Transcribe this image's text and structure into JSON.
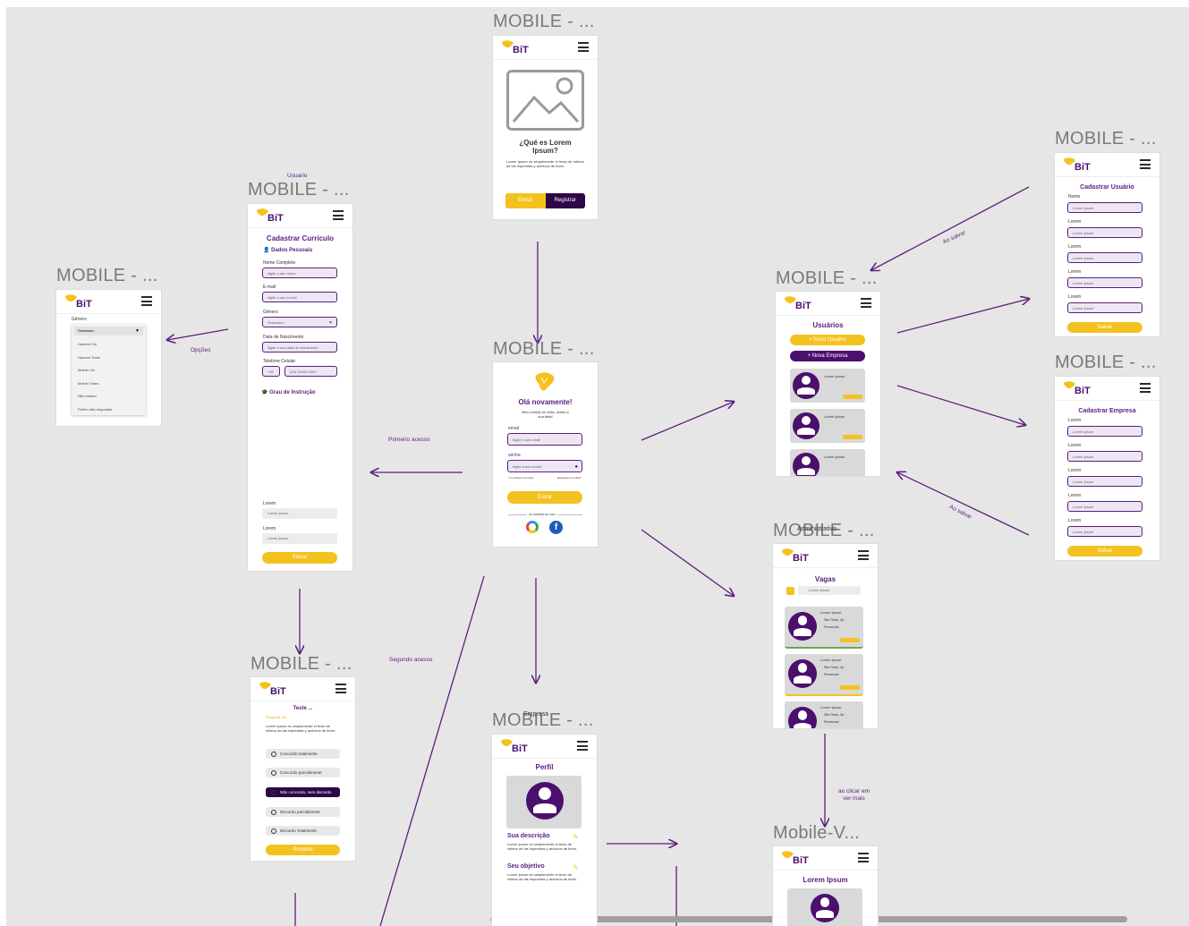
{
  "frame_titles": {
    "welcome": "MOBILE - ...",
    "opcoes": "MOBILE - ...",
    "curriculo": "MOBILE - ...",
    "login": "MOBILE - ...",
    "usuarios": "MOBILE - ...",
    "cad_usuario": "MOBILE - ...",
    "cad_empresa": "MOBILE - ...",
    "vagas": "MOBILE - ...",
    "teste": "MOBILE - ...",
    "perfil": "MOBILE - ...",
    "vermais": "Mobile-V..."
  },
  "logo_text": "BiT",
  "welcome": {
    "title": "¿Qué es Lorem Ipsum?",
    "text": "Lorem Ipsum es simplemente el texto de relleno de las imprentas y archivos de texto.",
    "btn_entrar": "Entrar",
    "btn_registrar": "Registrar"
  },
  "opcoes": {
    "label": "Gênero",
    "selected": "Selecione...",
    "options": [
      "Homem Cis",
      "Homem Trans",
      "Mulher Cis",
      "Mulher Trans",
      "Não-binário",
      "Prefiro não responder"
    ]
  },
  "curriculo": {
    "title": "Cadastrar Currículo",
    "section1": "Dados Pessoais",
    "nome_label": "Nome Completo",
    "nome_ph": "digite o seu nome",
    "email_label": "E-mail",
    "email_ph": "digite o seu e-mail",
    "genero_label": "Gênero",
    "genero_ph": "Selecione...",
    "nasc_label": "Data de Nascimento",
    "nasc_ph": "digite a sua data de nascimento",
    "tel_label": "Telefone Celular",
    "ddd": "+55",
    "tel_ph": "(00) 00000-0000",
    "section2": "Grau de Instrução",
    "lorem1_label": "Lorem",
    "lorem1_ph": "Lorem Ipsum",
    "lorem2_label": "Lorem",
    "lorem2_ph": "Lorem Ipsum",
    "salvar": "Salvar"
  },
  "login": {
    "greet": "Olá novamente!",
    "sub": "Bem-vind@ de volta, sentiu a sua falta!",
    "email_label": "email",
    "email_ph": "digite o seu email",
    "senha_label": "senha",
    "senha_ph": "digite a sua senha",
    "lembrar": "Lembrar meu login",
    "esqueci": "Esqueceu a senha?",
    "entrar": "Entrar",
    "ou": "ou conecte-se com"
  },
  "usuarios": {
    "title": "Usuários",
    "novo_usuario": "+ Novo Usuário",
    "nova_empresa": "+ Nova Empresa",
    "card_text": "Lorem Ipsum"
  },
  "cad_usuario": {
    "title": "Cadastrar Usuário",
    "fields": [
      "Nome",
      "Lorem",
      "Lorem",
      "Lorem",
      "Lorem"
    ],
    "ph": "Lorem Ipsum",
    "salvar": "Salvar"
  },
  "cad_empresa": {
    "title": "Cadastrar Empresa",
    "fields": [
      "Lorem",
      "Lorem",
      "Lorem",
      "Lorem",
      "Lorem"
    ],
    "ph": "Lorem Ipsum",
    "salvar": "Salvar"
  },
  "vagas": {
    "overlay": "Administrativo",
    "title": "Vagas",
    "search": "Lorem Ipsum",
    "card_title": "Lorem Ipsum",
    "city": "São Paulo, Sp",
    "mode": "Presencial"
  },
  "teste": {
    "title": "Teste ...",
    "question": "Pergunta 1/5",
    "text": "Lorem Ipsum es simplemente el texto de relleno de las imprentas y archivos de texto.",
    "options": [
      "Concordo totalmente",
      "Concordo parcialmente",
      "Não concordo, nem discordo",
      "Discordo parcialmente",
      "Discordo Totalmente"
    ],
    "proximo": "Próximo"
  },
  "perfil": {
    "overlay": "Empresa",
    "title": "Perfil",
    "desc_title": "Sua descrição",
    "desc_text": "Lorem Ipsum es simplemente el texto de relleno de las imprentas y archivos de texto.",
    "obj_title": "Seu objetivo",
    "obj_text": "Lorem Ipsum es simplemente el texto de relleno de las imprentas y archivos de texto."
  },
  "vermais": {
    "title": "Lorem Ipsum"
  },
  "notes": {
    "usuario": "Usuario",
    "opcoes": "Opções",
    "primeiro": "Primeiro acesso",
    "segundo": "Segundo acesso",
    "ao_salvar1": "Ao salvar",
    "ao_salvar2": "Ao salvar",
    "ao_clicar": "ao clicar em ver mais"
  },
  "colors": {
    "purple": "#4b0f6e",
    "yellow": "#f4c21f",
    "canvas": "#e6e6e6"
  }
}
